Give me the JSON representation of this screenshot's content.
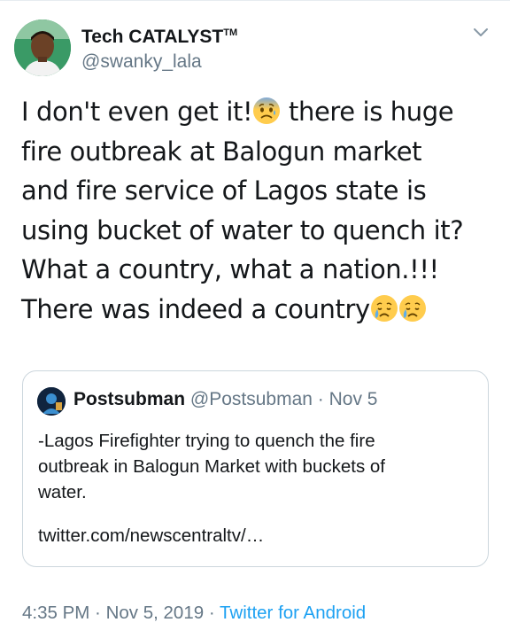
{
  "author": {
    "display_name": "Tech CATALYST",
    "trademark": "TM",
    "handle": "@swanky_lala"
  },
  "tweet": {
    "line1_a": "I don't even get it!",
    "line1_b": " there is huge",
    "line2": "fire outbreak at Balogun market",
    "line3": "and fire service of Lagos state is",
    "line4": "using bucket of water to quench it?",
    "line5": "What a country, what a nation.!!!",
    "line6": "There was indeed a country",
    "emojis": [
      "fearful-face",
      "crying-face",
      "crying-face"
    ]
  },
  "quote": {
    "name": "Postsubman",
    "handle": "@Postsubman",
    "separator": "·",
    "date": "Nov 5",
    "text_line1": "-Lagos Firefighter trying to quench the fire",
    "text_line2": "outbreak in Balogun Market with buckets of",
    "text_line3": "water.",
    "link": "twitter.com/newscentraltv/…"
  },
  "meta": {
    "time": "4:35 PM",
    "sep1": " · ",
    "date": "Nov 5, 2019",
    "sep2": " · ",
    "source": "Twitter for Android"
  },
  "colors": {
    "text": "#14171a",
    "secondary": "#657786",
    "link": "#1da1f2",
    "border": "#ccd6dd"
  }
}
